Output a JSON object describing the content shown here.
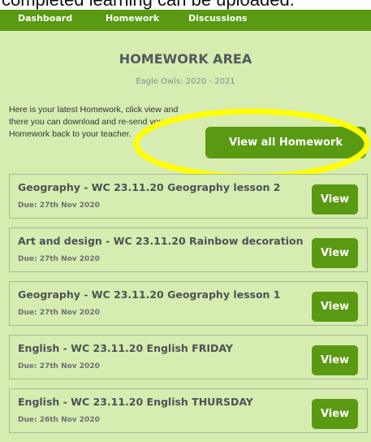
{
  "caption": "completed learning can be uploaded.",
  "nav": {
    "items": [
      {
        "label": "Dashboard"
      },
      {
        "label": "Homework"
      },
      {
        "label": "Discussions"
      }
    ]
  },
  "page": {
    "title": "HOMEWORK AREA",
    "subtitle": "Eagle Owls: 2020 - 2021",
    "intro": "Here is your latest Homework, click view and there you can download and re-send your Homework back to your teacher.",
    "view_all_label": "View all Homework",
    "highlight_color": "#ffff00"
  },
  "colors": {
    "brand_green": "#5a9a12",
    "background": "#d6ecb0"
  },
  "homework": [
    {
      "title": "Geography - WC 23.11.20 Geography lesson 2",
      "due": "Due: 27th Nov 2020",
      "action": "View"
    },
    {
      "title": "Art and design - WC 23.11.20 Rainbow decoration",
      "due": "Due: 27th Nov 2020",
      "action": "View"
    },
    {
      "title": "Geography - WC 23.11.20 Geography lesson 1",
      "due": "Due: 27th Nov 2020",
      "action": "View"
    },
    {
      "title": "English - WC 23.11.20 English FRIDAY",
      "due": "Due: 27th Nov 2020",
      "action": "View"
    },
    {
      "title": "English - WC 23.11.20 English THURSDAY",
      "due": "Due: 26th Nov 2020",
      "action": "View"
    }
  ]
}
